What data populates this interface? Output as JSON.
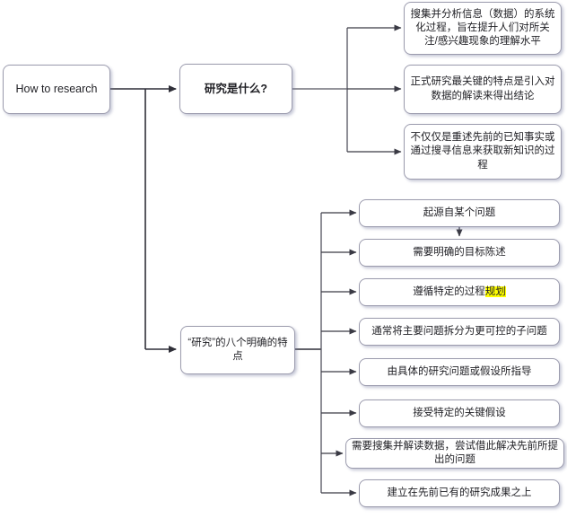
{
  "diagram": {
    "type": "flowchart",
    "title_node": "How to research",
    "root": {
      "label": "How to research"
    },
    "question_node": {
      "label": "研究是什么?"
    },
    "definitions": [
      {
        "label": "搜集并分析信息（数据）的系统化过程，旨在提升人们对所关注/感兴趣现象的理解水平"
      },
      {
        "label": "正式研究最关键的特点是引入对数据的解读来得出结论"
      },
      {
        "label": "不仅仅是重述先前的已知事实或通过搜寻信息来获取新知识的过程"
      }
    ],
    "features_root": {
      "label": "“研究”的八个明确的特点"
    },
    "features": [
      {
        "label_plain": "起源自某个问题",
        "highlight": ""
      },
      {
        "label_plain": "需要明确的目标陈述",
        "highlight": ""
      },
      {
        "label_plain": "遵循特定的过程",
        "highlight": "规划"
      },
      {
        "label_plain": "通常将主要问题拆分为更可控的子问题",
        "highlight": ""
      },
      {
        "label_plain": "由具体的研究问题或假设所指导",
        "highlight": ""
      },
      {
        "label_plain": "接受特定的关键假设",
        "highlight": ""
      },
      {
        "label_plain": "需要搜集并解读数据，尝试借此解决先前所提出的问题",
        "highlight": ""
      },
      {
        "label_plain": "建立在先前已有的研究成果之上",
        "highlight": ""
      }
    ],
    "colors": {
      "node_border": "#9b9bad",
      "node_fill": "#ffffff",
      "edge": "#3a3a44",
      "edge_light": "#8a8a99",
      "highlight": "#ffff00",
      "text": "#1f1f24"
    }
  }
}
